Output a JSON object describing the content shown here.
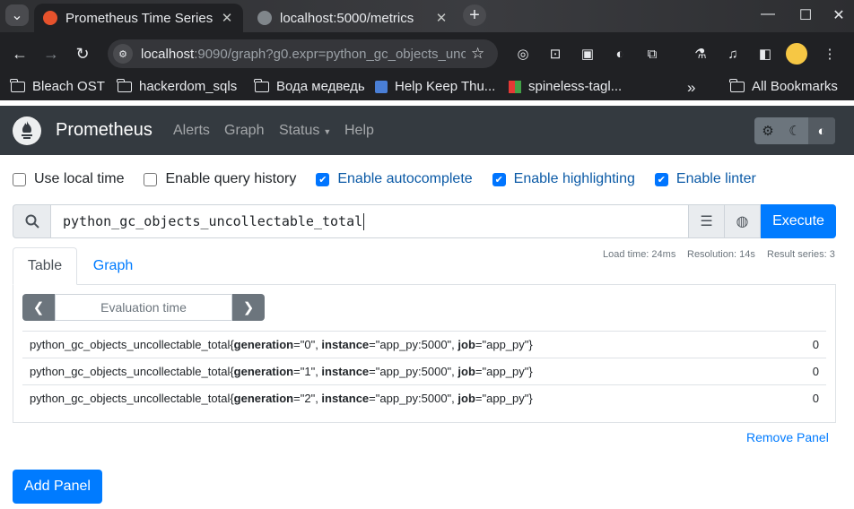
{
  "browser": {
    "tabs": [
      {
        "title": "Prometheus Time Series",
        "active": true
      },
      {
        "title": "localhost:5000/metrics",
        "active": false
      }
    ],
    "url_host": "localhost",
    "url_rest": ":9090/graph?g0.expr=python_gc_objects_unc...",
    "bookmarks": [
      "Bleach OST",
      "hackerdom_sqls",
      "Вода медведь",
      "Help Keep Thu...",
      "spineless-tagl...",
      "»",
      "All Bookmarks"
    ]
  },
  "navbar": {
    "brand": "Prometheus",
    "links": [
      "Alerts",
      "Graph",
      "Status",
      "Help"
    ]
  },
  "options": [
    {
      "label": "Use local time",
      "checked": false
    },
    {
      "label": "Enable query history",
      "checked": false
    },
    {
      "label": "Enable autocomplete",
      "checked": true
    },
    {
      "label": "Enable highlighting",
      "checked": true
    },
    {
      "label": "Enable linter",
      "checked": true
    }
  ],
  "query": {
    "expression": "python_gc_objects_uncollectable_total",
    "execute_label": "Execute"
  },
  "stats": {
    "load_time": "Load time: 24ms",
    "resolution": "Resolution: 14s",
    "result_series": "Result series: 3"
  },
  "panel": {
    "tabs": [
      "Table",
      "Graph"
    ],
    "eval_placeholder": "Evaluation time",
    "rows": [
      {
        "metric": "python_gc_objects_uncollectable_total",
        "labels": [
          [
            "generation",
            "0"
          ],
          [
            "instance",
            "app_py:5000"
          ],
          [
            "job",
            "app_py"
          ]
        ],
        "value": "0"
      },
      {
        "metric": "python_gc_objects_uncollectable_total",
        "labels": [
          [
            "generation",
            "1"
          ],
          [
            "instance",
            "app_py:5000"
          ],
          [
            "job",
            "app_py"
          ]
        ],
        "value": "0"
      },
      {
        "metric": "python_gc_objects_uncollectable_total",
        "labels": [
          [
            "generation",
            "2"
          ],
          [
            "instance",
            "app_py:5000"
          ],
          [
            "job",
            "app_py"
          ]
        ],
        "value": "0"
      }
    ],
    "remove_label": "Remove Panel"
  },
  "add_panel_label": "Add Panel"
}
